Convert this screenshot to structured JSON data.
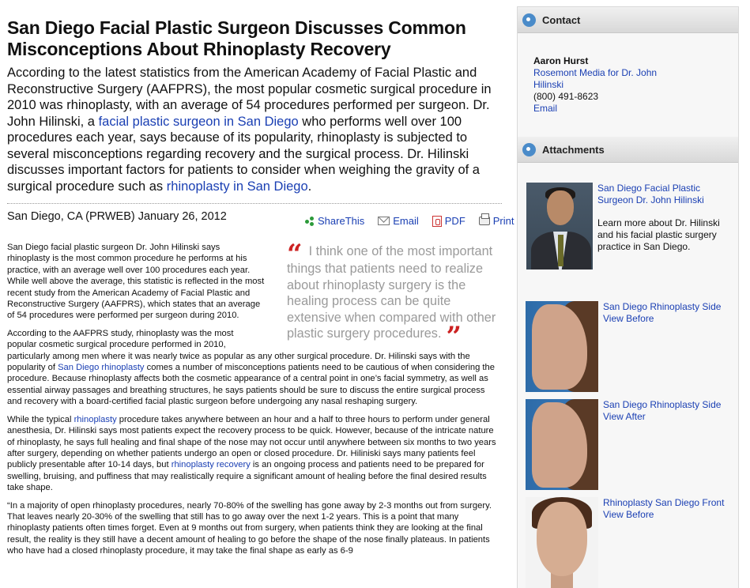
{
  "article": {
    "headline": "San Diego Facial Plastic Surgeon Discusses Common Misconceptions About Rhinoplasty Recovery",
    "summary": {
      "t1": "According to the latest statistics from the American Academy of Facial Plastic and Reconstructive Surgery (AAFPRS), the most popular cosmetic surgical procedure in 2010 was rhinoplasty, with an average of 54 procedures performed per surgeon. Dr. John Hilinski, a ",
      "link1": "facial plastic surgeon in San Diego",
      "t2": " who performs well over 100 procedures each year, says because of its popularity, rhinoplasty is subjected to several misconceptions regarding recovery and the surgical process. Dr. Hilinski discusses important factors for patients to consider when weighing the gravity of a surgical procedure such as ",
      "link2": "rhinoplasty in San Diego",
      "t3": "."
    },
    "dateline": "San Diego, CA (PRWEB) January 26, 2012",
    "share": {
      "sharethis": "ShareThis",
      "email": "Email",
      "pdf": "PDF",
      "print": "Print"
    },
    "pullquote": "I think one of the most important things that patients need to realize about rhinoplasty surgery is the healing process can be quite extensive when compared with other plastic surgery procedures.",
    "quote_open": "“",
    "quote_close": "”",
    "p1": "San Diego facial plastic surgeon Dr. John Hilinski says rhinoplasty is the most common procedure he performs at his practice, with an average well over 100 procedures each year. While well above the average, this statistic is reflected in the most recent study from the American Academy of Facial Plastic and Reconstructive Surgery (AAFPRS), which states that an average of 54 procedures were performed per surgeon during 2010.",
    "p2": {
      "t1": "According to the AAFPRS study, rhinoplasty was the most popular cosmetic surgical procedure performed in 2010, particularly among men where it was nearly twice as popular as any other surgical procedure. Dr. Hilinski says with the popularity of ",
      "link": "San Diego rhinoplasty",
      "t2": " comes a number of misconceptions patients need to be cautious of when considering the procedure. Because rhinoplasty affects both the cosmetic appearance of a central point in one’s facial symmetry, as well as essential airway passages and breathing structures, he says patients should be sure to discuss the entire surgical process and recovery with a board-certified facial plastic surgeon before undergoing any nasal reshaping surgery."
    },
    "p3": {
      "t1": "While the typical ",
      "link1": "rhinoplasty",
      "t2": " procedure takes anywhere between an hour and a half to three hours to perform under general anesthesia, Dr. Hilinski says most patients expect the recovery process to be quick. However, because of the intricate nature of rhinoplasty, he says full healing and final shape of the nose may not occur until anywhere between six months to two years after surgery, depending on whether patients undergo an open or closed procedure. Dr. Hiliniski says many patients feel publicly presentable after 10-14 days, but ",
      "link2": "rhinoplasty recovery",
      "t3": " is an ongoing process and patients need to be prepared for swelling, bruising, and puffiness that may realistically require a significant amount of healing before the final desired results take shape."
    },
    "p4": "“In a majority of open rhinoplasty procedures, nearly 70-80% of the swelling has gone away by 2-3 months out from surgery. That leaves nearly 20-30% of the swelling that still has to go away over the next 1-2 years. This is a point that many rhinoplasty patients often times forget. Even at 9 months out from surgery, when patients think they are looking at the final result, the reality is they still have a decent amount of healing to go before the shape of the nose finally plateaus. In patients who have had a closed rhinoplasty procedure, it may take the final shape as early as 6-9"
  },
  "sidebar": {
    "contact": {
      "title": "Contact",
      "name": "Aaron Hurst",
      "org": "Rosemont Media for Dr. John Hilinski",
      "phone": "(800) 491-8623",
      "email": "Email"
    },
    "attachments": {
      "title": "Attachments",
      "items": [
        {
          "title": "San Diego Facial Plastic Surgeon Dr. John Hilinski",
          "desc": "Learn more about Dr. Hilinski and his facial plastic surgery practice in San Diego."
        },
        {
          "title": "San Diego Rhinoplasty Side View Before"
        },
        {
          "title": "San Diego Rhinoplasty Side View After"
        },
        {
          "title": "Rhinoplasty San Diego Front View Before"
        }
      ]
    }
  }
}
